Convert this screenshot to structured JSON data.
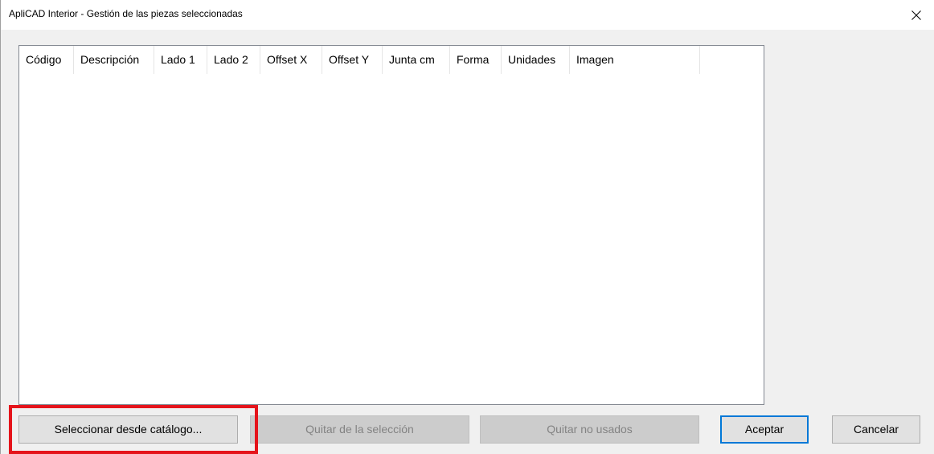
{
  "window": {
    "title": "ApliCAD Interior - Gestión de las piezas seleccionadas",
    "close_icon": "close-icon"
  },
  "list": {
    "columns": [
      {
        "label": "Código"
      },
      {
        "label": "Descripción"
      },
      {
        "label": "Lado 1"
      },
      {
        "label": "Lado 2"
      },
      {
        "label": "Offset X"
      },
      {
        "label": "Offset Y"
      },
      {
        "label": "Junta cm"
      },
      {
        "label": "Forma"
      },
      {
        "label": "Unidades"
      },
      {
        "label": "Imagen"
      }
    ],
    "rows": []
  },
  "buttons": {
    "select_from_catalog": "Seleccionar desde catálogo...",
    "remove_from_selection": "Quitar de la selección",
    "remove_unused": "Quitar no usados",
    "accept": "Aceptar",
    "cancel": "Cancelar"
  },
  "colors": {
    "highlight": "#e5141b",
    "default_button_border": "#0078d7"
  }
}
